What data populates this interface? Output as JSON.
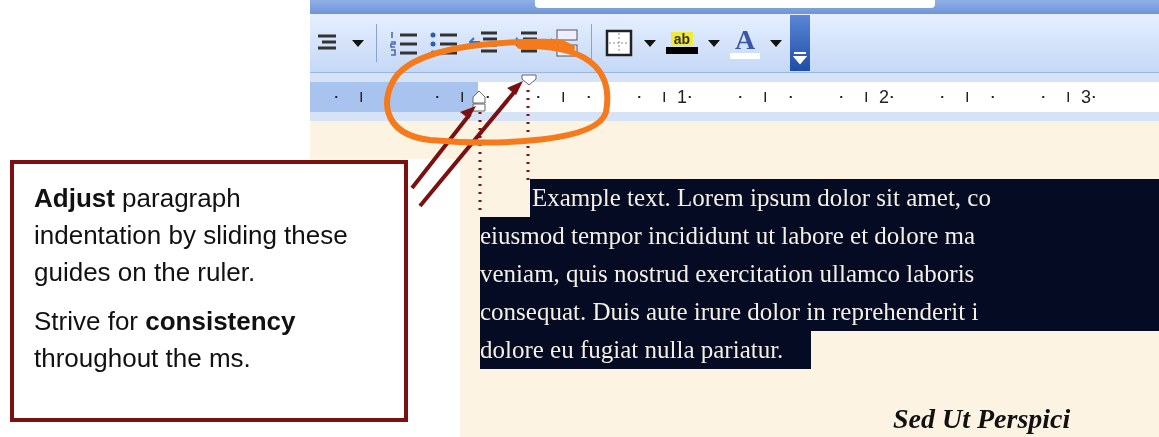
{
  "toolbar": {
    "buttons": [
      {
        "kind": "list"
      },
      {
        "kind": "dropdown"
      },
      {
        "kind": "separator"
      },
      {
        "kind": "numbering"
      },
      {
        "kind": "bullets"
      },
      {
        "kind": "decrease-indent"
      },
      {
        "kind": "increase-indent"
      },
      {
        "kind": "page-break"
      },
      {
        "kind": "separator"
      },
      {
        "kind": "borders"
      },
      {
        "kind": "dropdown"
      },
      {
        "kind": "highlight",
        "glyph": "ab"
      },
      {
        "kind": "dropdown"
      },
      {
        "kind": "font-color",
        "glyph": "A"
      },
      {
        "kind": "dropdown"
      },
      {
        "kind": "options"
      }
    ]
  },
  "ruler": {
    "labels": [
      "1",
      "2",
      "3"
    ]
  },
  "document": {
    "paragraph": {
      "selected": true,
      "lines": [
        "Example text. Lorem ipsum dolor sit amet, co",
        "eiusmod tempor incididunt ut labore et dolore ma",
        "veniam, quis nostrud exercitation ullamco laboris",
        "consequat. Duis aute irure dolor in reprehenderit i",
        "dolore eu fugiat nulla pariatur."
      ]
    },
    "heading": "Sed Ut Perspici"
  },
  "callout": {
    "paragraphs": [
      "**Adjust** paragraph indentation by sliding these guides on the ruler.",
      "Strive for **consistency** throughout the ms."
    ]
  }
}
